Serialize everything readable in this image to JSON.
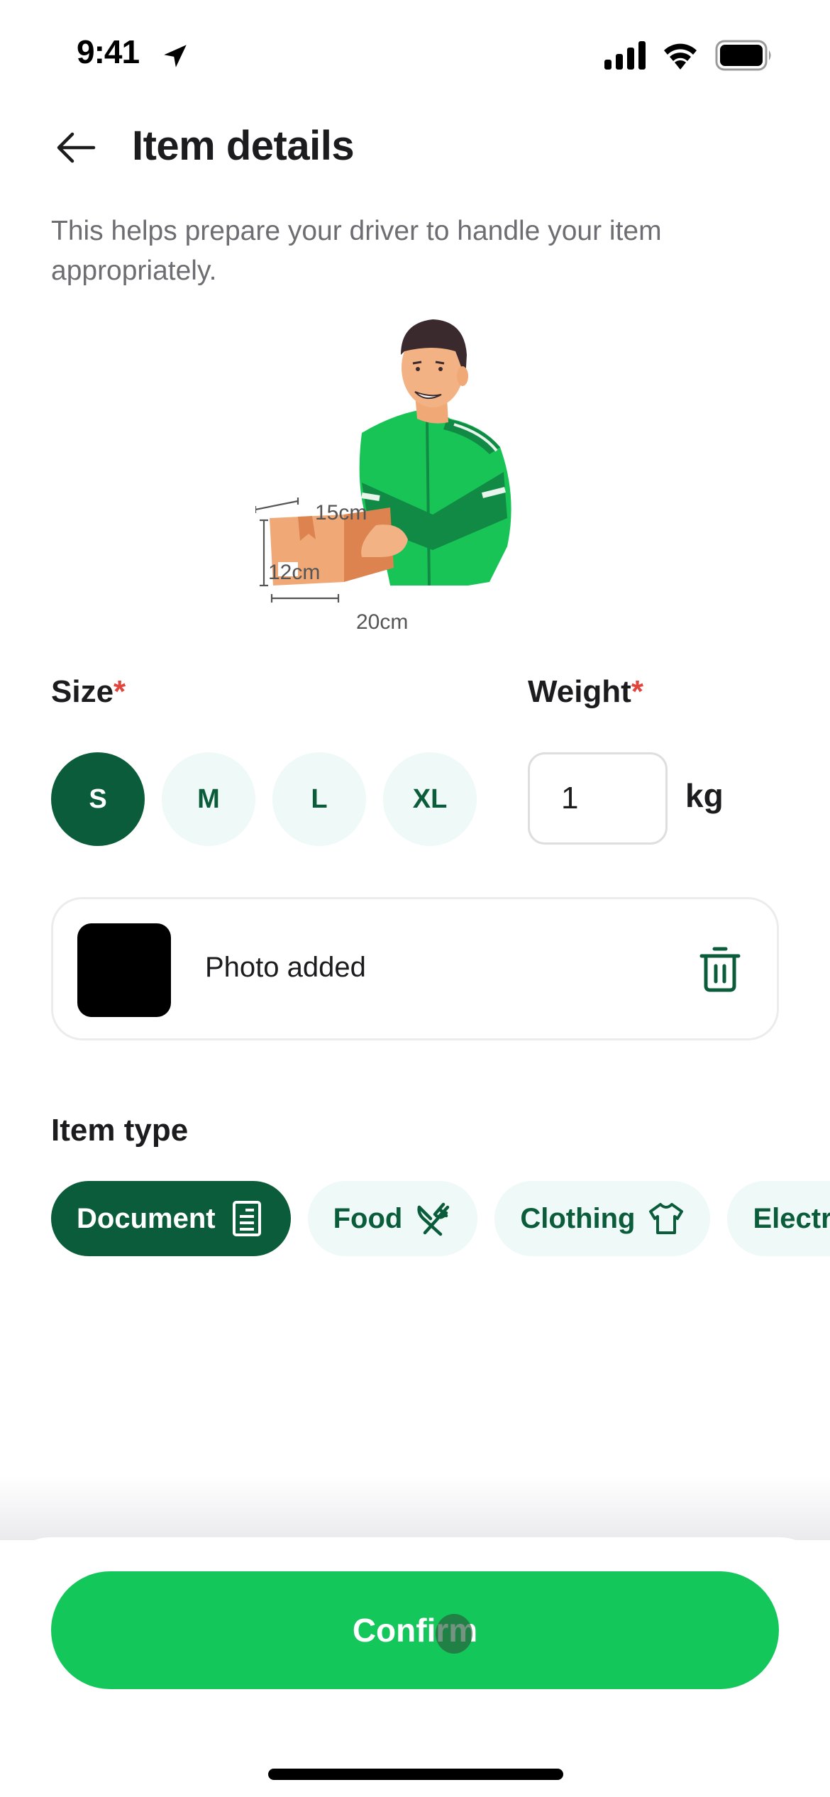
{
  "status_bar": {
    "time": "9:41",
    "icons": [
      "location-arrow-icon",
      "cellular-signal-icon",
      "wifi-icon",
      "battery-icon"
    ]
  },
  "header": {
    "back_icon": "arrow-left-icon",
    "title": "Item details",
    "description": "This helps prepare your driver to handle your item appropriately."
  },
  "illustration": {
    "subject": "driver-holding-box",
    "dimensions": {
      "depth": "15cm",
      "height": "12cm",
      "width": "20cm"
    },
    "colors": {
      "jacket": "#19c457",
      "jacket_dark": "#118a45",
      "box": "#f0a877",
      "box_dark": "#dd8350"
    }
  },
  "size": {
    "label": "Size",
    "required_mark": "*",
    "options": [
      {
        "label": "S",
        "selected": true
      },
      {
        "label": "M",
        "selected": false
      },
      {
        "label": "L",
        "selected": false
      },
      {
        "label": "XL",
        "selected": false
      }
    ]
  },
  "weight": {
    "label": "Weight",
    "required_mark": "*",
    "value": "1",
    "unit": "kg"
  },
  "photo": {
    "status_text": "Photo added",
    "delete_icon": "trash-icon"
  },
  "item_type": {
    "label": "Item type",
    "options": [
      {
        "label": "Document",
        "icon": "document-icon",
        "selected": true
      },
      {
        "label": "Food",
        "icon": "fork-knife-icon",
        "selected": false
      },
      {
        "label": "Clothing",
        "icon": "tshirt-icon",
        "selected": false
      },
      {
        "label": "Electronics",
        "icon": "electronics-icon",
        "selected": false
      }
    ]
  },
  "footer": {
    "confirm_label": "Confirm"
  },
  "colors": {
    "primary_dark": "#0b5c3b",
    "primary_green": "#14c75a",
    "chip_bg": "#eef9f8",
    "required": "#e0463f",
    "text_secondary": "#6d6d72"
  }
}
